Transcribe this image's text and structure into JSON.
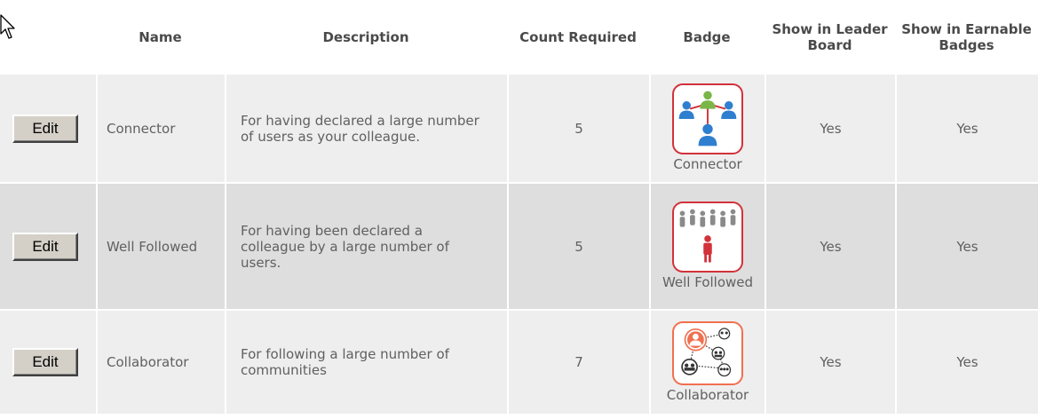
{
  "headers": {
    "name": "Name",
    "description": "Description",
    "count_required": "Count Required",
    "badge": "Badge",
    "show_leader_board": "Show in Leader Board",
    "show_earnable_badges": "Show in Earnable Badges"
  },
  "rows": [
    {
      "edit_label": "Edit",
      "name": "Connector",
      "description": "For having declared a large number of users as your colleague.",
      "count": "5",
      "badge_icon": "connector-badge-icon",
      "badge_caption": "Connector",
      "leader_board": "Yes",
      "earnable": "Yes"
    },
    {
      "edit_label": "Edit",
      "name": "Well Followed",
      "description": "For having been declared a colleague by a large number of users.",
      "count": "5",
      "badge_icon": "well-followed-badge-icon",
      "badge_caption": "Well Followed",
      "leader_board": "Yes",
      "earnable": "Yes"
    },
    {
      "edit_label": "Edit",
      "name": "Collaborator",
      "description": "For following a large number of communities",
      "count": "7",
      "badge_icon": "collaborator-badge-icon",
      "badge_caption": "Collaborator",
      "leader_board": "Yes",
      "earnable": "Yes"
    }
  ],
  "colors": {
    "row_light": "#eeeeee",
    "row_dark": "#dedede",
    "badge_border_red": "#d2323a",
    "badge_border_orange": "#f07050",
    "person_blue": "#2f7fd0",
    "person_red": "#d2323a",
    "person_green": "#7ab648"
  }
}
